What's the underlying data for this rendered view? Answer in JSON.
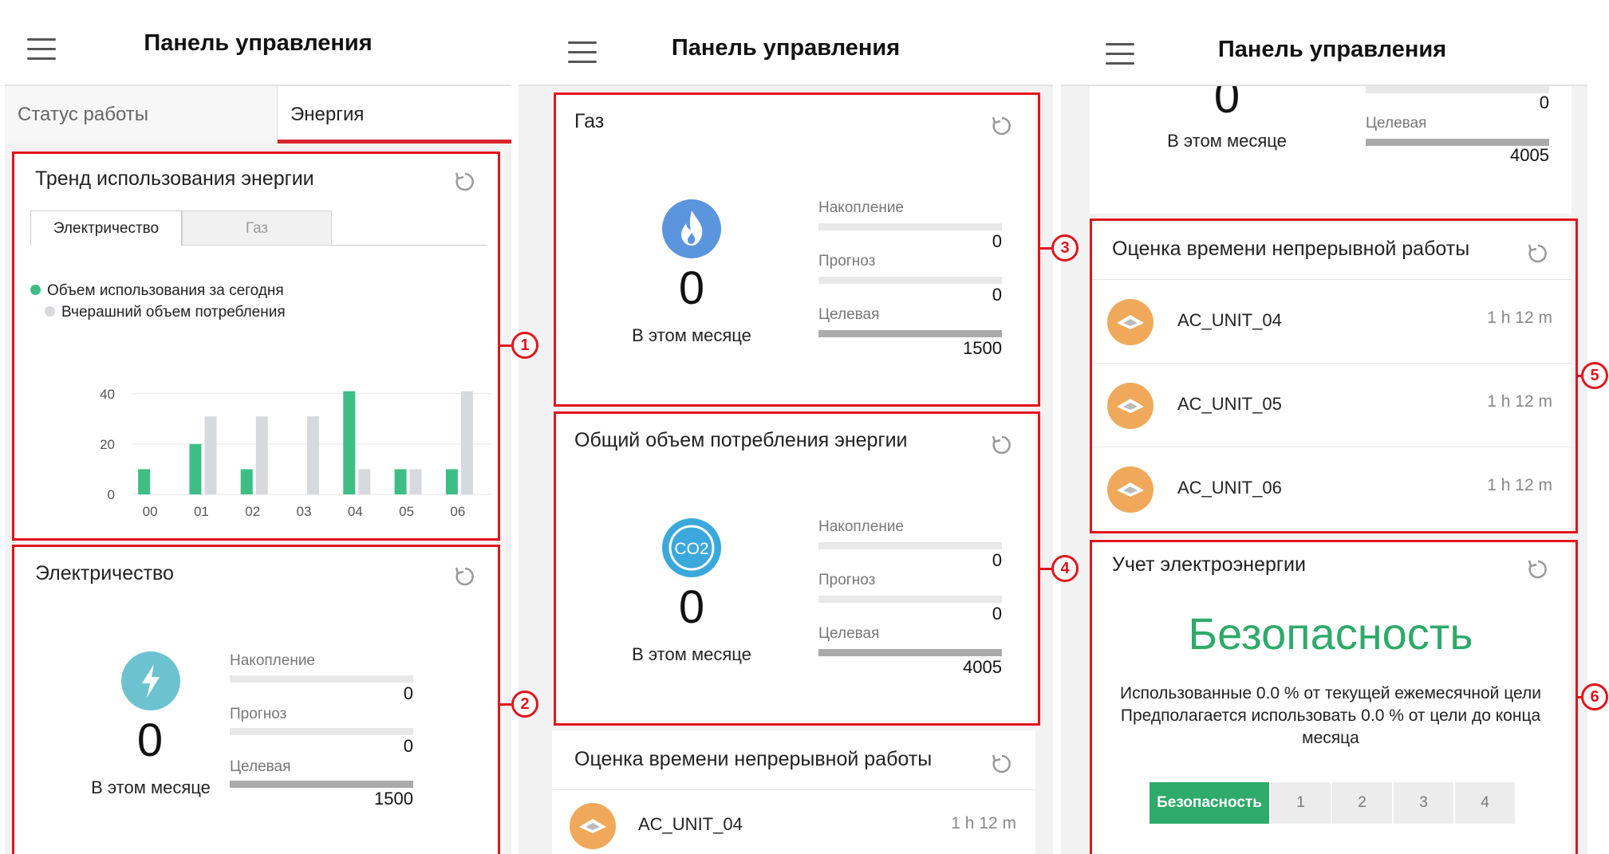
{
  "app_title": "Панель управления",
  "tabs": {
    "status": "Статус работы",
    "energy": "Энергия"
  },
  "colors": {
    "accent_red": "#e2141b",
    "green": "#3dbe85",
    "gray_bar": "#d6d9dd",
    "safe_green": "#2eaa6a",
    "elec_icon": "#6cc3cf",
    "gas_icon": "#5b95de",
    "co2_icon": "#3aa8dc",
    "unit_icon": "#f0a95a"
  },
  "callouts": [
    "1",
    "2",
    "3",
    "4",
    "5",
    "6"
  ],
  "trend": {
    "title": "Тренд использования энергии",
    "subtabs": {
      "electricity": "Электричество",
      "gas": "Газ"
    },
    "legend": {
      "today": "Объем использования за сегодня",
      "yesterday": "Вчерашний объем потребления"
    }
  },
  "chart_data": {
    "type": "bar",
    "categories": [
      "00",
      "01",
      "02",
      "03",
      "04",
      "05",
      "06"
    ],
    "series": [
      {
        "name": "Объем использования за сегодня",
        "values": [
          10,
          20,
          10,
          0,
          41,
          10,
          10
        ],
        "color": "#3dbe85"
      },
      {
        "name": "Вчерашний объем потребления",
        "values": [
          0,
          31,
          31,
          31,
          10,
          10,
          41
        ],
        "color": "#d6d9dd"
      }
    ],
    "yticks": [
      "0",
      "20",
      "40"
    ],
    "ylim": [
      0,
      45
    ],
    "grid": true,
    "legend_position": "top-left"
  },
  "meter_labels": {
    "accum": "Накопление",
    "forecast": "Прогноз",
    "target": "Целевая",
    "this_month": "В этом месяце"
  },
  "electricity": {
    "title": "Электричество",
    "month_value": "0",
    "accum": "0",
    "forecast": "0",
    "target": "1500",
    "icon": "lightning-icon"
  },
  "gas": {
    "title": "Газ",
    "month_value": "0",
    "accum": "0",
    "forecast": "0",
    "target": "1500",
    "icon": "flame-icon"
  },
  "total": {
    "title": "Общий объем потребления энергии",
    "month_value": "0",
    "accum": "0",
    "forecast": "0",
    "target": "4005",
    "icon": "co2-icon",
    "icon_text": "CO2"
  },
  "runtime": {
    "title": "Оценка времени непрерывной работы",
    "units": [
      {
        "name": "AC_UNIT_04",
        "time": "1 h 12 m"
      },
      {
        "name": "AC_UNIT_05",
        "time": "1 h 12 m"
      },
      {
        "name": "AC_UNIT_06",
        "time": "1 h 12 m"
      }
    ]
  },
  "metering": {
    "title": "Учет электроэнергии",
    "status": "Безопасность",
    "line1": "Использованные 0.0 % от текущей ежемесячной цели",
    "line2": "Предполагается использовать 0.0 % от цели до конца",
    "line3": "месяца",
    "levels": [
      "Безопасность",
      "1",
      "2",
      "3",
      "4"
    ]
  },
  "partial": {
    "month_value": "0",
    "target_label": "Целевая",
    "accum": "0",
    "target": "4005",
    "caption": "В этом месяце"
  }
}
